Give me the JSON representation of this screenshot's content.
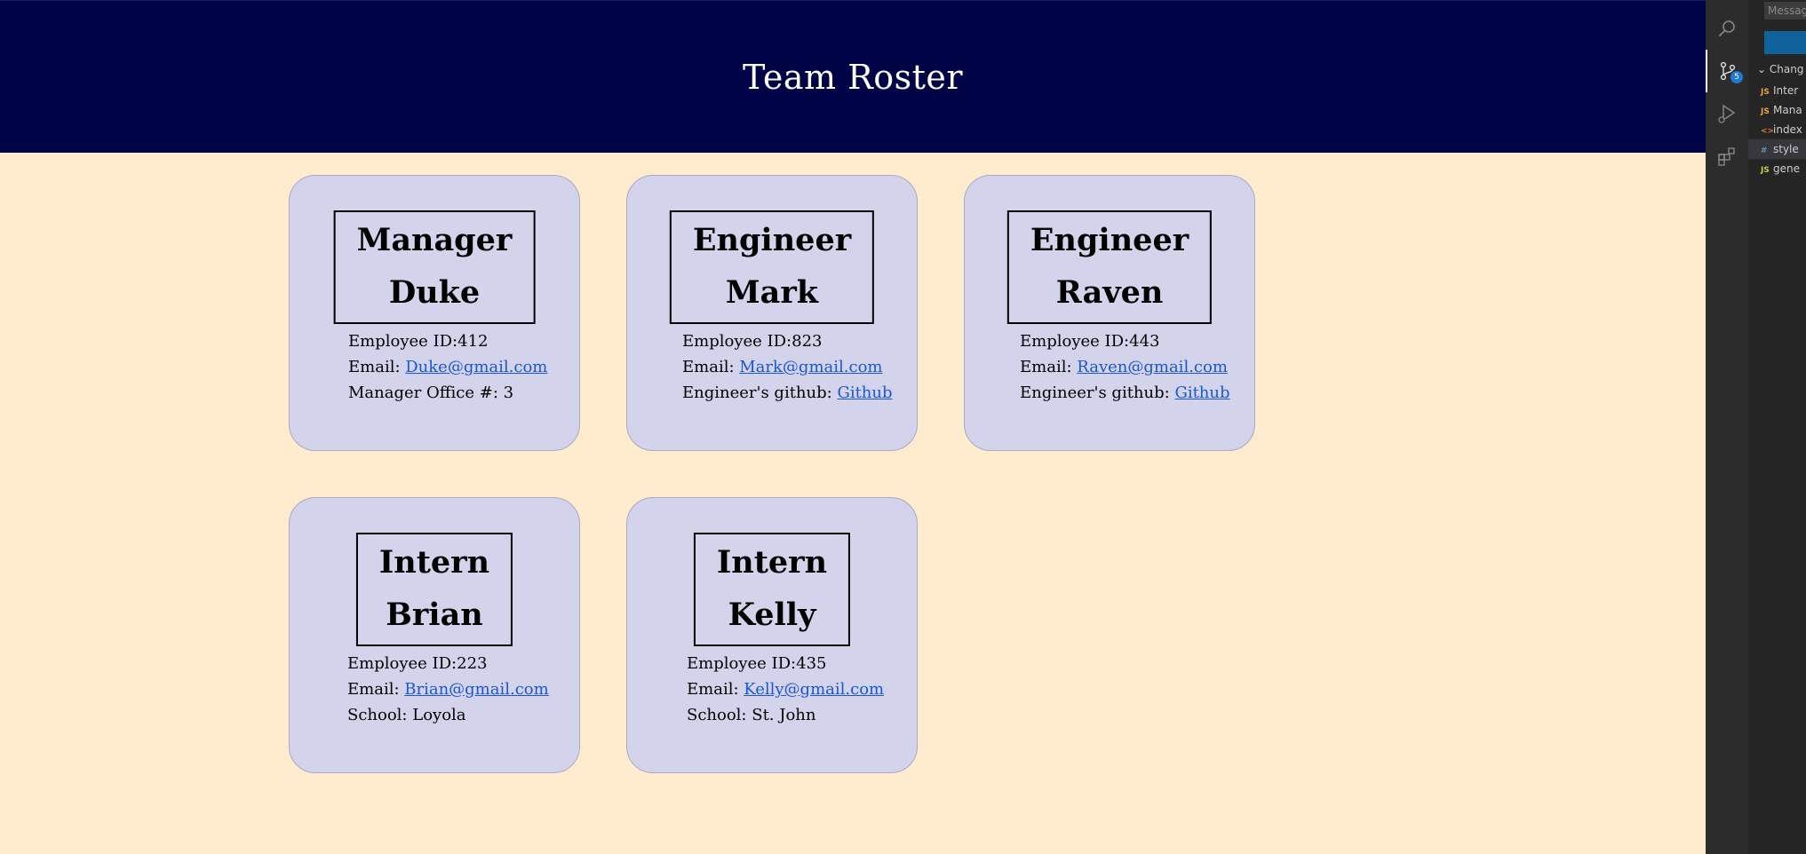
{
  "page": {
    "title": "Team Roster",
    "cards": [
      {
        "role": "Manager",
        "name": "Duke",
        "id_label": "Employee ID:",
        "id": "412",
        "email_label": "Email: ",
        "email": "Duke@gmail.com",
        "extra_label": "Manager Office #: ",
        "extra_value": "3"
      },
      {
        "role": "Engineer",
        "name": "Mark",
        "id_label": "Employee ID:",
        "id": "823",
        "email_label": "Email: ",
        "email": "Mark@gmail.com",
        "extra_label": "Engineer's github: ",
        "extra_link": "Github"
      },
      {
        "role": "Engineer",
        "name": "Raven",
        "id_label": "Employee ID:",
        "id": "443",
        "email_label": "Email: ",
        "email": "Raven@gmail.com",
        "extra_label": "Engineer's github: ",
        "extra_link": "Github"
      },
      {
        "role": "Intern",
        "name": "Brian",
        "id_label": "Employee ID:",
        "id": "223",
        "email_label": "Email: ",
        "email": "Brian@gmail.com",
        "extra_label": "School: ",
        "extra_value": "Loyola"
      },
      {
        "role": "Intern",
        "name": "Kelly",
        "id_label": "Employee ID:",
        "id": "435",
        "email_label": "Email: ",
        "email": "Kelly@gmail.com",
        "extra_label": "School: ",
        "extra_value": "St. John"
      }
    ],
    "colors": {
      "header_bg": "#000345",
      "page_bg": "#ffebcd",
      "card_bg": "#d3d3eb",
      "link": "#1a56d6"
    }
  },
  "vscode": {
    "activity_icons": [
      "search-icon",
      "source-control-icon",
      "run-debug-icon",
      "extensions-icon"
    ],
    "scm_badge": "5",
    "message_placeholder": "Messag",
    "changes_label": "Chang",
    "files": [
      {
        "type": "JS",
        "name": "Inter",
        "icon_color": "#e8a33d"
      },
      {
        "type": "JS",
        "name": "Mana",
        "icon_color": "#e8a33d"
      },
      {
        "type": "<>",
        "name": "index",
        "icon_color": "#e37933"
      },
      {
        "type": "#",
        "name": "style",
        "icon_color": "#519aba"
      },
      {
        "type": "JS",
        "name": "gene",
        "icon_color": "#cbcb41"
      }
    ]
  }
}
